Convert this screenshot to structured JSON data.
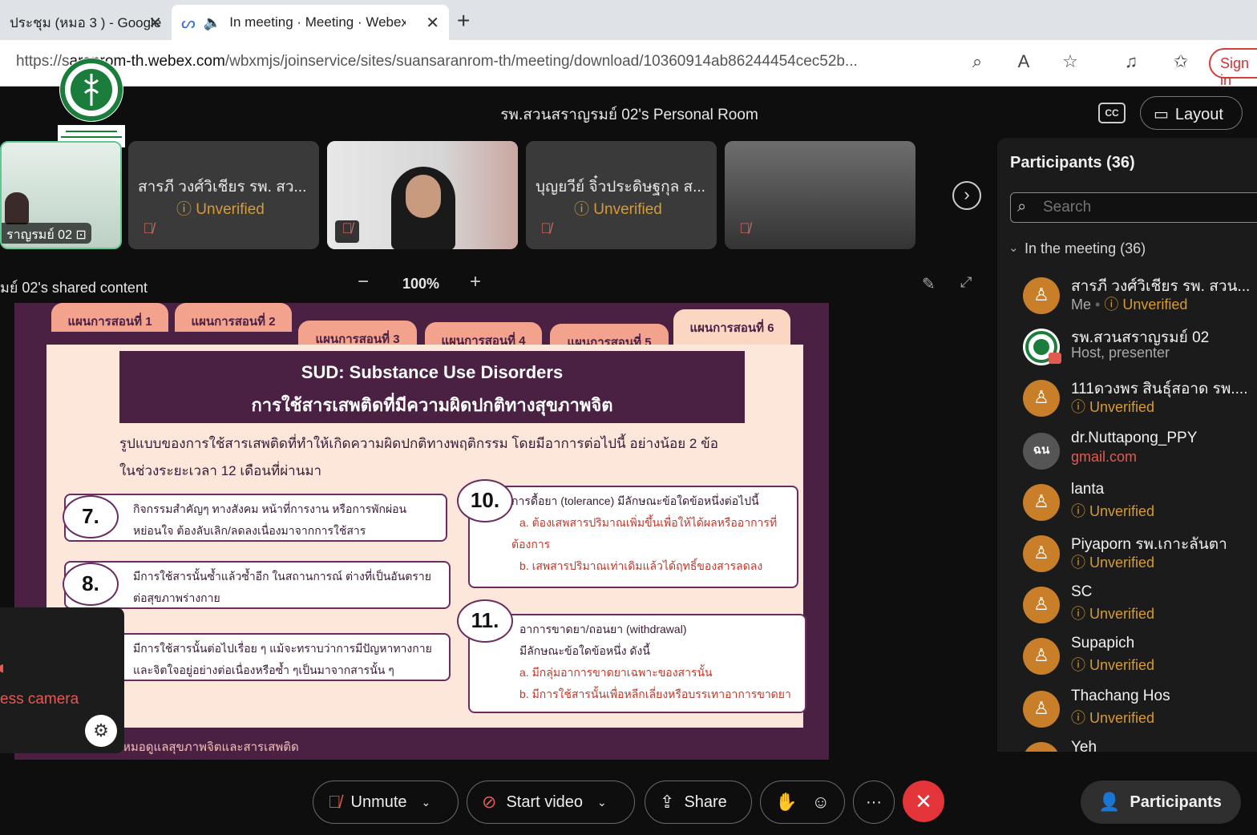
{
  "browser": {
    "tabs": [
      {
        "title": "ประชุม (หมอ 3 ) - Google"
      },
      {
        "title": "In meeting · Meeting · Webex"
      }
    ],
    "url_prefix": "https://s",
    "url_host": "aranrom-th.webex.com",
    "url_path": "/wbxmjs/joinservice/sites/suansaranrom-th/meeting/download/10360914ab86244454cec52b...",
    "sign_in": "Sign in"
  },
  "meeting": {
    "title": "รพ.สวนสราญรมย์ 02's Personal Room",
    "cc_label": "CC",
    "layout_label": "Layout"
  },
  "thumbnails": [
    {
      "name": "ราญรมย์ 02"
    },
    {
      "name": "สารภี วงศ์วิเชียร รพ. สว...",
      "status": "Unverified"
    },
    {
      "name": ""
    },
    {
      "name": "บุญยวีย์ จิ๋วประดิษฐกุล ส...",
      "status": "Unverified"
    },
    {
      "name": ""
    }
  ],
  "share": {
    "label": "มย์ 02's shared content",
    "zoom": "100%"
  },
  "slide": {
    "tabs": [
      "แผนการสอนที่ 1",
      "แผนการสอนที่ 2",
      "แผนการสอนที่ 3",
      "แผนการสอนที่ 4",
      "แผนการสอนที่ 5",
      "แผนการสอนที่ 6"
    ],
    "title_en": "SUD: Substance Use Disorders",
    "title_th": "การใช้สารเสพติดที่มีความผิดปกติทางสุขภาพจิต",
    "intro1": "รูปแบบของการใช้สารเสพติดที่ทำให้เกิดความผิดปกติทางพฤติกรรม โดยมีอาการต่อไปนี้ อย่างน้อย 2 ข้อ",
    "intro2": "ในช่วงระยะเวลา 12 เดือนที่ผ่านมา",
    "c7_num": "7.",
    "c7_l1": "กิจกรรมสำคัญๆ ทางสังคม หน้าที่การงาน หรือการพักผ่อน",
    "c7_l2": "หย่อนใจ ต้องลับเลิก/ลดลงเนื่องมาจากการใช้สาร",
    "c8_num": "8.",
    "c8_l1": "มีการใช้สารนั้นซ้ำแล้วซ้ำอีก ในสถานการณ์ ต่างที่เป็นอันตราย",
    "c8_l2": "ต่อสุขภาพร่างกาย",
    "c9_l1": "มีการใช้สารนั้นต่อไปเรื่อย ๆ แม้จะทราบว่าการมีปัญหาทางกาย",
    "c9_l2": "และจิตใจอยู่อย่างต่อเนื่องหรือซ้ำ ๆเป็นมาจากสารนั้น ๆ",
    "c10_num": "10.",
    "c10_l1": "การดื้อยา (tolerance) มีลักษณะข้อใดข้อหนึ่งต่อไปนี้",
    "c10_l2": "a. ต้องเสพสารปริมาณเพิ่มขึ้นเพื่อให้ได้ผลหรืออาการที่",
    "c10_l3": "ต้องการ",
    "c10_l4": "b. เสพสารปริมาณเท่าเดิมแล้วได้ฤทธิ์ของสารลดลง",
    "c11_num": "11.",
    "c11_l1": "อาการขาดยา/ถอนยา (withdrawal)",
    "c11_l2": "มีลักษณะข้อใดข้อหนึ่ง ดังนี้",
    "c11_l3": "a. มีกลุ่มอาการขาดยาเฉพาะของสารนั้น",
    "c11_l4": "b. มีการใช้สารนั้นเพื่อหลีกเลี่ยงหรือบรรเทาอาการขาดยา",
    "footer": "หมอดูแลสุขภาพจิตและสารเสพติด"
  },
  "self_view": {
    "camera_text": "ess camera"
  },
  "participants_panel": {
    "title": "Participants (36)",
    "search_placeholder": "Search",
    "section": "In the meeting (36)",
    "list": [
      {
        "name": "สารภี วงศ์วิเชียร รพ. สวน...",
        "role": "Me",
        "status": "Unverified"
      },
      {
        "name": "รพ.สวนสราญรมย์ 02",
        "role": "Host, presenter"
      },
      {
        "name": "111ดวงพร สินธุ์สอาด รพ....",
        "status": "Unverified"
      },
      {
        "name": "dr.Nuttapong_PPY",
        "email": "gmail.com",
        "initials": "ฉน"
      },
      {
        "name": "lanta",
        "status": "Unverified"
      },
      {
        "name": "Piyaporn รพ.เกาะลันตา",
        "status": "Unverified"
      },
      {
        "name": "SC",
        "status": "Unverified"
      },
      {
        "name": "Supapich",
        "status": "Unverified"
      },
      {
        "name": "Thachang Hos",
        "status": "Unverified"
      },
      {
        "name": "Yeh"
      }
    ]
  },
  "controls": {
    "unmute": "Unmute",
    "start_video": "Start video",
    "share": "Share",
    "more": "···",
    "leave": "✕",
    "participants": "Participants"
  },
  "colors": {
    "unverified": "#d79a34",
    "leave": "#e3343a",
    "slide_purple": "#4a2043",
    "slide_tab": "#f3a28d"
  }
}
